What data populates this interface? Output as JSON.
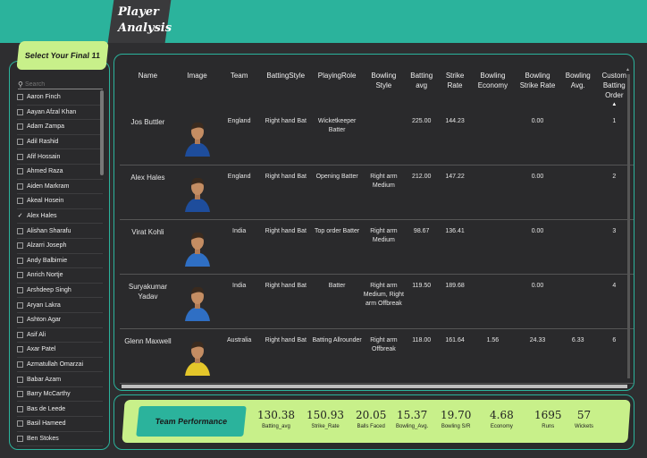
{
  "header": {
    "title_line1": "Player",
    "title_line2": "Analysis"
  },
  "colors": {
    "accent": "#2bb39c",
    "highlight": "#c8f08a",
    "background": "#2e2e30"
  },
  "slicer": {
    "button_label": "Select Your Final 11",
    "search_placeholder": "Search",
    "items": [
      {
        "label": "Aaron Finch",
        "checked": false
      },
      {
        "label": "Aayan Afzal Khan",
        "checked": false
      },
      {
        "label": "Adam Zampa",
        "checked": false
      },
      {
        "label": "Adil Rashid",
        "checked": false
      },
      {
        "label": "Afif Hossain",
        "checked": false
      },
      {
        "label": "Ahmed Raza",
        "checked": false
      },
      {
        "label": "Aiden Markram",
        "checked": false
      },
      {
        "label": "Akeal Hosein",
        "checked": false
      },
      {
        "label": "Alex Hales",
        "checked": true
      },
      {
        "label": "Alishan Sharafu",
        "checked": false
      },
      {
        "label": "Alzarri Joseph",
        "checked": false
      },
      {
        "label": "Andy Balbirnie",
        "checked": false
      },
      {
        "label": "Anrich Nortje",
        "checked": false
      },
      {
        "label": "Arshdeep Singh",
        "checked": false
      },
      {
        "label": "Aryan Lakra",
        "checked": false
      },
      {
        "label": "Ashton Agar",
        "checked": false
      },
      {
        "label": "Asif Ali",
        "checked": false
      },
      {
        "label": "Axar Patel",
        "checked": false
      },
      {
        "label": "Azmatullah Omarzai",
        "checked": false
      },
      {
        "label": "Babar Azam",
        "checked": false
      },
      {
        "label": "Barry McCarthy",
        "checked": false
      },
      {
        "label": "Bas de Leede",
        "checked": false
      },
      {
        "label": "Basil Hameed",
        "checked": false
      },
      {
        "label": "Ben Stokes",
        "checked": false
      }
    ]
  },
  "table": {
    "columns": [
      "Name",
      "Image",
      "Team",
      "BattingStyle",
      "PlayingRole",
      "Bowling Style",
      "Batting avg",
      "Strike Rate",
      "Bowling Economy",
      "Bowling Strike Rate",
      "Bowling Avg.",
      "Custom Batting Order"
    ],
    "rows": [
      {
        "name": "Jos Buttler",
        "image": "player-photo",
        "jersey": "#1e4d9c",
        "team": "England",
        "batting_style": "Right hand Bat",
        "playing_role": "Wicketkeeper Batter",
        "bowling_style": "",
        "batting_avg": "225.00",
        "strike_rate": "144.23",
        "bowling_economy": "",
        "bowling_strike_rate": "0.00",
        "bowling_avg": "",
        "order": "1"
      },
      {
        "name": "Alex Hales",
        "image": "player-photo",
        "jersey": "#1e4d9c",
        "team": "England",
        "batting_style": "Right hand Bat",
        "playing_role": "Opening Batter",
        "bowling_style": "Right arm Medium",
        "batting_avg": "212.00",
        "strike_rate": "147.22",
        "bowling_economy": "",
        "bowling_strike_rate": "0.00",
        "bowling_avg": "",
        "order": "2"
      },
      {
        "name": "Virat Kohli",
        "image": "player-photo",
        "jersey": "#2f6fc4",
        "team": "India",
        "batting_style": "Right hand Bat",
        "playing_role": "Top order Batter",
        "bowling_style": "Right arm Medium",
        "batting_avg": "98.67",
        "strike_rate": "136.41",
        "bowling_economy": "",
        "bowling_strike_rate": "0.00",
        "bowling_avg": "",
        "order": "3"
      },
      {
        "name": "Suryakumar Yadav",
        "image": "player-photo",
        "jersey": "#2f6fc4",
        "team": "India",
        "batting_style": "Right hand Bat",
        "playing_role": "Batter",
        "bowling_style": "Right arm Medium, Right arm Offbreak",
        "batting_avg": "119.50",
        "strike_rate": "189.68",
        "bowling_economy": "",
        "bowling_strike_rate": "0.00",
        "bowling_avg": "",
        "order": "4"
      },
      {
        "name": "Glenn Maxwell",
        "image": "player-photo",
        "jersey": "#e4c62a",
        "team": "Australia",
        "batting_style": "Right hand Bat",
        "playing_role": "Batting Allrounder",
        "bowling_style": "Right arm Offbreak",
        "batting_avg": "118.00",
        "strike_rate": "161.64",
        "bowling_economy": "1.56",
        "bowling_strike_rate": "24.33",
        "bowling_avg": "6.33",
        "order": "6"
      }
    ]
  },
  "performance": {
    "title": "Team Performance",
    "kpis": [
      {
        "value": "130.38",
        "label": "Batting_avg"
      },
      {
        "value": "150.93",
        "label": "Strike_Rate"
      },
      {
        "value": "20.05",
        "label": "Balls Faced"
      },
      {
        "value": "15.37",
        "label": "Bowling_Avg."
      },
      {
        "value": "19.70",
        "label": "Bowling S/R"
      },
      {
        "value": "4.68",
        "label": "Economy"
      },
      {
        "value": "1695",
        "label": "Runs"
      },
      {
        "value": "57",
        "label": "Wickets"
      }
    ]
  }
}
